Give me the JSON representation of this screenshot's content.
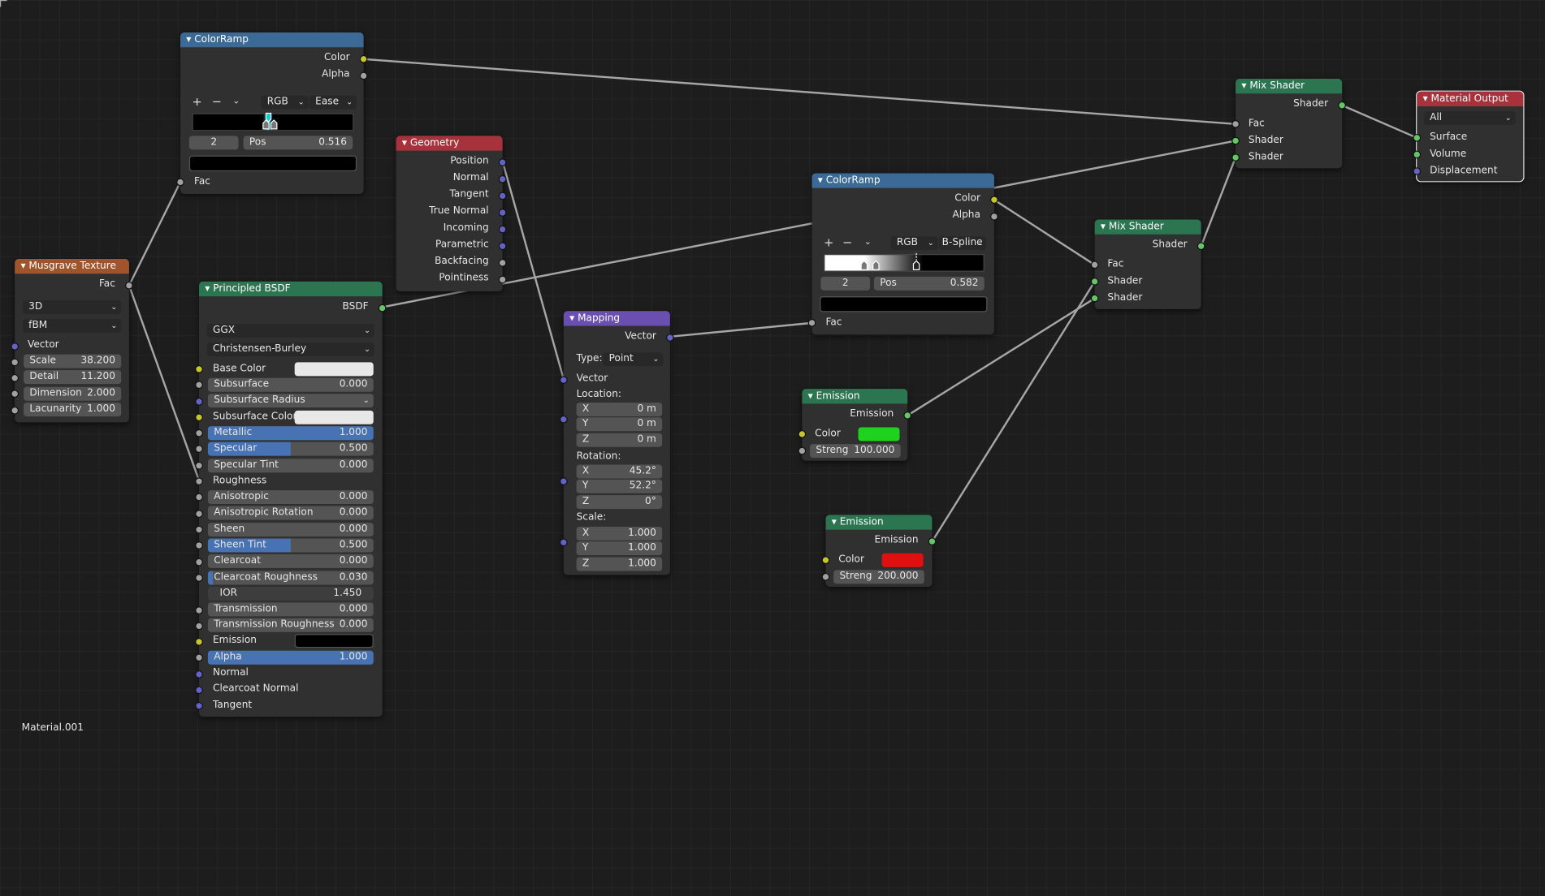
{
  "colorramp1": {
    "title": "ColorRamp",
    "outputs": [
      "Color",
      "Alpha"
    ],
    "mode": "RGB",
    "interp": "Ease",
    "stop_index": "2",
    "pos_label": "Pos",
    "pos_value": "0.516",
    "input": "Fac",
    "stop_color": "#000000"
  },
  "colorramp2": {
    "title": "ColorRamp",
    "outputs": [
      "Color",
      "Alpha"
    ],
    "mode": "RGB",
    "interp": "B-Spline",
    "stop_index": "2",
    "pos_label": "Pos",
    "pos_value": "0.582",
    "input": "Fac",
    "stop_color": "#000000"
  },
  "geometry": {
    "title": "Geometry",
    "outputs": [
      "Position",
      "Normal",
      "Tangent",
      "True Normal",
      "Incoming",
      "Parametric",
      "Backfacing",
      "Pointiness"
    ]
  },
  "musgrave": {
    "title": "Musgrave Texture",
    "output": "Fac",
    "dimensions": "3D",
    "type": "fBM",
    "vector": "Vector",
    "fields": [
      {
        "label": "Scale",
        "value": "38.200"
      },
      {
        "label": "Detail",
        "value": "11.200"
      },
      {
        "label": "Dimension",
        "value": "2.000"
      },
      {
        "label": "Lacunarity",
        "value": "1.000"
      }
    ]
  },
  "bsdf": {
    "title": "Principled BSDF",
    "output": "BSDF",
    "distribution": "GGX",
    "subsurface_method": "Christensen-Burley",
    "base_color_label": "Base Color",
    "base_color": "#e8e8e8",
    "subsurface": {
      "label": "Subsurface",
      "value": "0.000"
    },
    "subsurface_radius": "Subsurface Radius",
    "subsurface_color_label": "Subsurface Color",
    "subsurface_color": "#e8e8e8",
    "metallic": {
      "label": "Metallic",
      "value": "1.000",
      "fraction": 1.0
    },
    "specular": {
      "label": "Specular",
      "value": "0.500",
      "fraction": 0.5
    },
    "specular_tint": {
      "label": "Specular Tint",
      "value": "0.000"
    },
    "roughness": "Roughness",
    "anisotropic": {
      "label": "Anisotropic",
      "value": "0.000"
    },
    "anisotropic_rotation": {
      "label": "Anisotropic Rotation",
      "value": "0.000"
    },
    "sheen": {
      "label": "Sheen",
      "value": "0.000"
    },
    "sheen_tint": {
      "label": "Sheen Tint",
      "value": "0.500",
      "fraction": 0.5
    },
    "clearcoat": {
      "label": "Clearcoat",
      "value": "0.000"
    },
    "clearcoat_roughness": {
      "label": "Clearcoat Roughness",
      "value": "0.030",
      "fraction": 0.03
    },
    "ior": {
      "label": "IOR",
      "value": "1.450"
    },
    "transmission": {
      "label": "Transmission",
      "value": "0.000"
    },
    "transmission_roughness": {
      "label": "Transmission Roughness",
      "value": "0.000"
    },
    "emission_label": "Emission",
    "emission_color": "#000000",
    "alpha": {
      "label": "Alpha",
      "value": "1.000",
      "fraction": 1.0
    },
    "normal": "Normal",
    "clearcoat_normal": "Clearcoat Normal",
    "tangent": "Tangent"
  },
  "mapping": {
    "title": "Mapping",
    "output": "Vector",
    "type_label": "Type:",
    "type_value": "Point",
    "vector": "Vector",
    "location_label": "Location:",
    "location": [
      {
        "axis": "X",
        "value": "0 m"
      },
      {
        "axis": "Y",
        "value": "0 m"
      },
      {
        "axis": "Z",
        "value": "0 m"
      }
    ],
    "rotation_label": "Rotation:",
    "rotation": [
      {
        "axis": "X",
        "value": "45.2°"
      },
      {
        "axis": "Y",
        "value": "52.2°"
      },
      {
        "axis": "Z",
        "value": "0°"
      }
    ],
    "scale_label": "Scale:",
    "scale": [
      {
        "axis": "X",
        "value": "1.000"
      },
      {
        "axis": "Y",
        "value": "1.000"
      },
      {
        "axis": "Z",
        "value": "1.000"
      }
    ]
  },
  "emission1": {
    "title": "Emission",
    "output": "Emission",
    "color_label": "Color",
    "color": "#1ed21e",
    "strength_label": "Streng",
    "strength": "100.000"
  },
  "emission2": {
    "title": "Emission",
    "output": "Emission",
    "color_label": "Color",
    "color": "#e01010",
    "strength_label": "Streng",
    "strength": "200.000"
  },
  "mix1": {
    "title": "Mix Shader",
    "output": "Shader",
    "inputs": [
      "Fac",
      "Shader",
      "Shader"
    ]
  },
  "mix2": {
    "title": "Mix Shader",
    "output": "Shader",
    "inputs": [
      "Fac",
      "Shader",
      "Shader"
    ]
  },
  "output": {
    "title": "Material Output",
    "target": "All",
    "inputs": [
      "Surface",
      "Volume",
      "Displacement"
    ]
  },
  "material_name": "Material.001",
  "colors": {
    "wire": "#a6a6a6",
    "header_ramp": "#3a6a95",
    "header_shader": "#2c7551",
    "header_texture": "#a0542c",
    "header_input": "#a8323c",
    "header_vector": "#6a4fb0",
    "accent": "#4772b3"
  }
}
